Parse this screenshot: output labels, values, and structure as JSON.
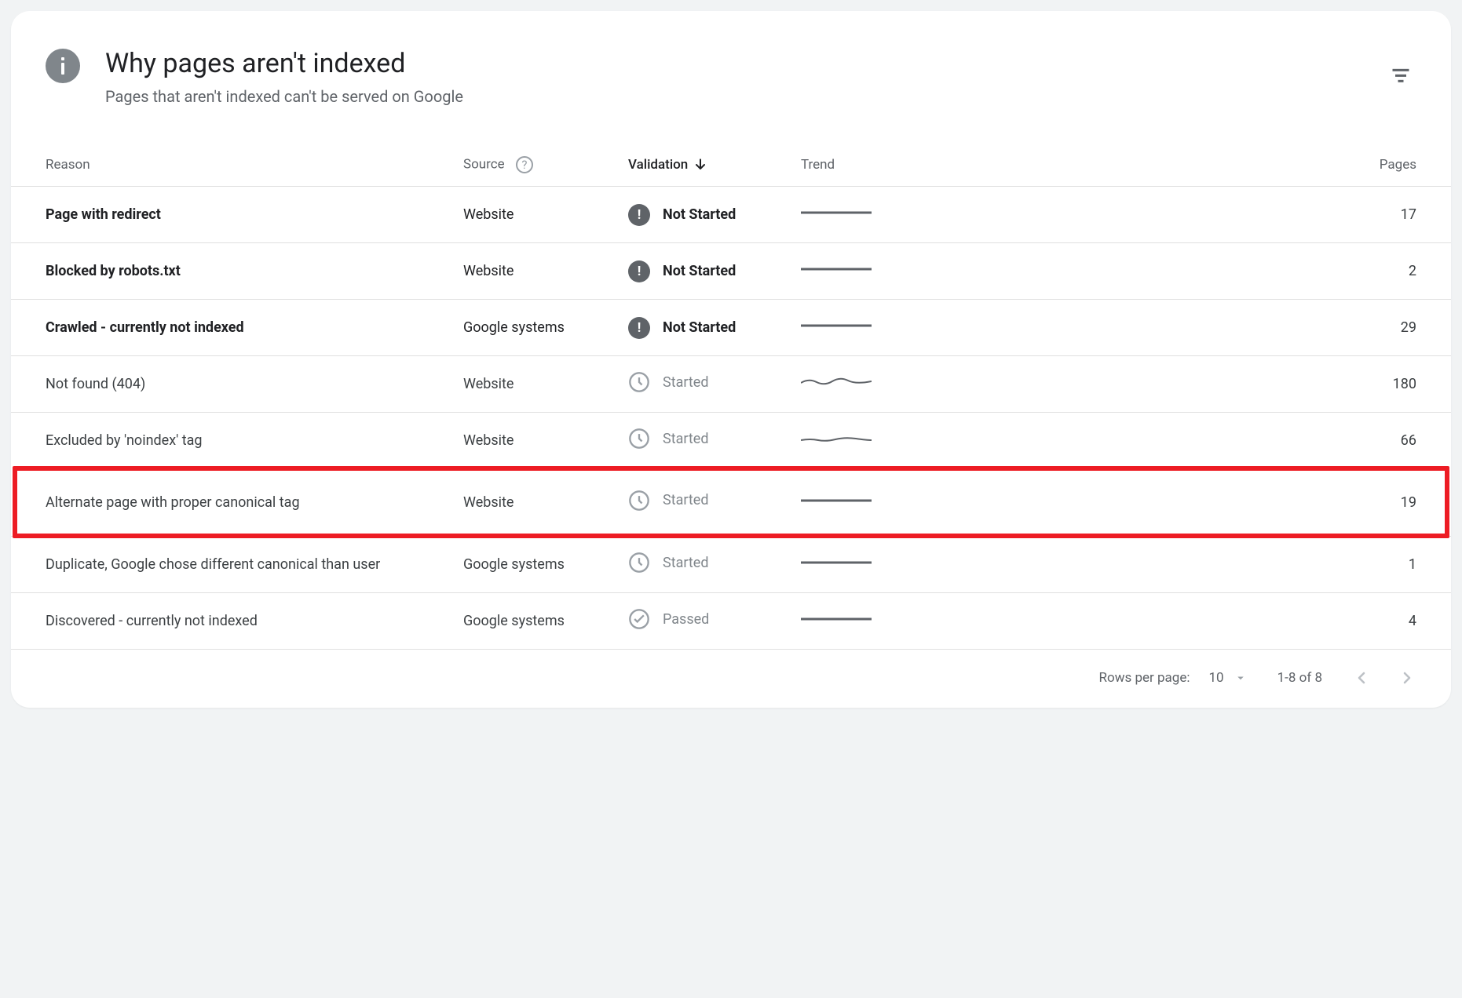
{
  "header": {
    "title": "Why pages aren't indexed",
    "subtitle": "Pages that aren't indexed can't be served on Google"
  },
  "columns": {
    "reason": "Reason",
    "source": "Source",
    "validation": "Validation",
    "trend": "Trend",
    "pages": "Pages"
  },
  "validation_labels": {
    "not_started": "Not Started",
    "started": "Started",
    "passed": "Passed"
  },
  "rows": [
    {
      "reason": "Page with redirect",
      "source": "Website",
      "validation": "not_started",
      "pages": "17",
      "bold": true,
      "spark": "flat"
    },
    {
      "reason": "Blocked by robots.txt",
      "source": "Website",
      "validation": "not_started",
      "pages": "2",
      "bold": true,
      "spark": "flat"
    },
    {
      "reason": "Crawled - currently not indexed",
      "source": "Google systems",
      "validation": "not_started",
      "pages": "29",
      "bold": true,
      "spark": "flat"
    },
    {
      "reason": "Not found (404)",
      "source": "Website",
      "validation": "started",
      "pages": "180",
      "bold": false,
      "spark": "wavy"
    },
    {
      "reason": "Excluded by 'noindex' tag",
      "source": "Website",
      "validation": "started",
      "pages": "66",
      "bold": false,
      "spark": "wavy2"
    },
    {
      "reason": "Alternate page with proper canonical tag",
      "source": "Website",
      "validation": "started",
      "pages": "19",
      "bold": false,
      "highlight": true,
      "spark": "flat"
    },
    {
      "reason": "Duplicate, Google chose different canonical than user",
      "source": "Google systems",
      "validation": "started",
      "pages": "1",
      "bold": false,
      "spark": "flat"
    },
    {
      "reason": "Discovered - currently not indexed",
      "source": "Google systems",
      "validation": "passed",
      "pages": "4",
      "bold": false,
      "spark": "flat"
    }
  ],
  "footer": {
    "rows_per_page_label": "Rows per page:",
    "rows_per_page_value": "10",
    "range": "1-8 of 8"
  }
}
